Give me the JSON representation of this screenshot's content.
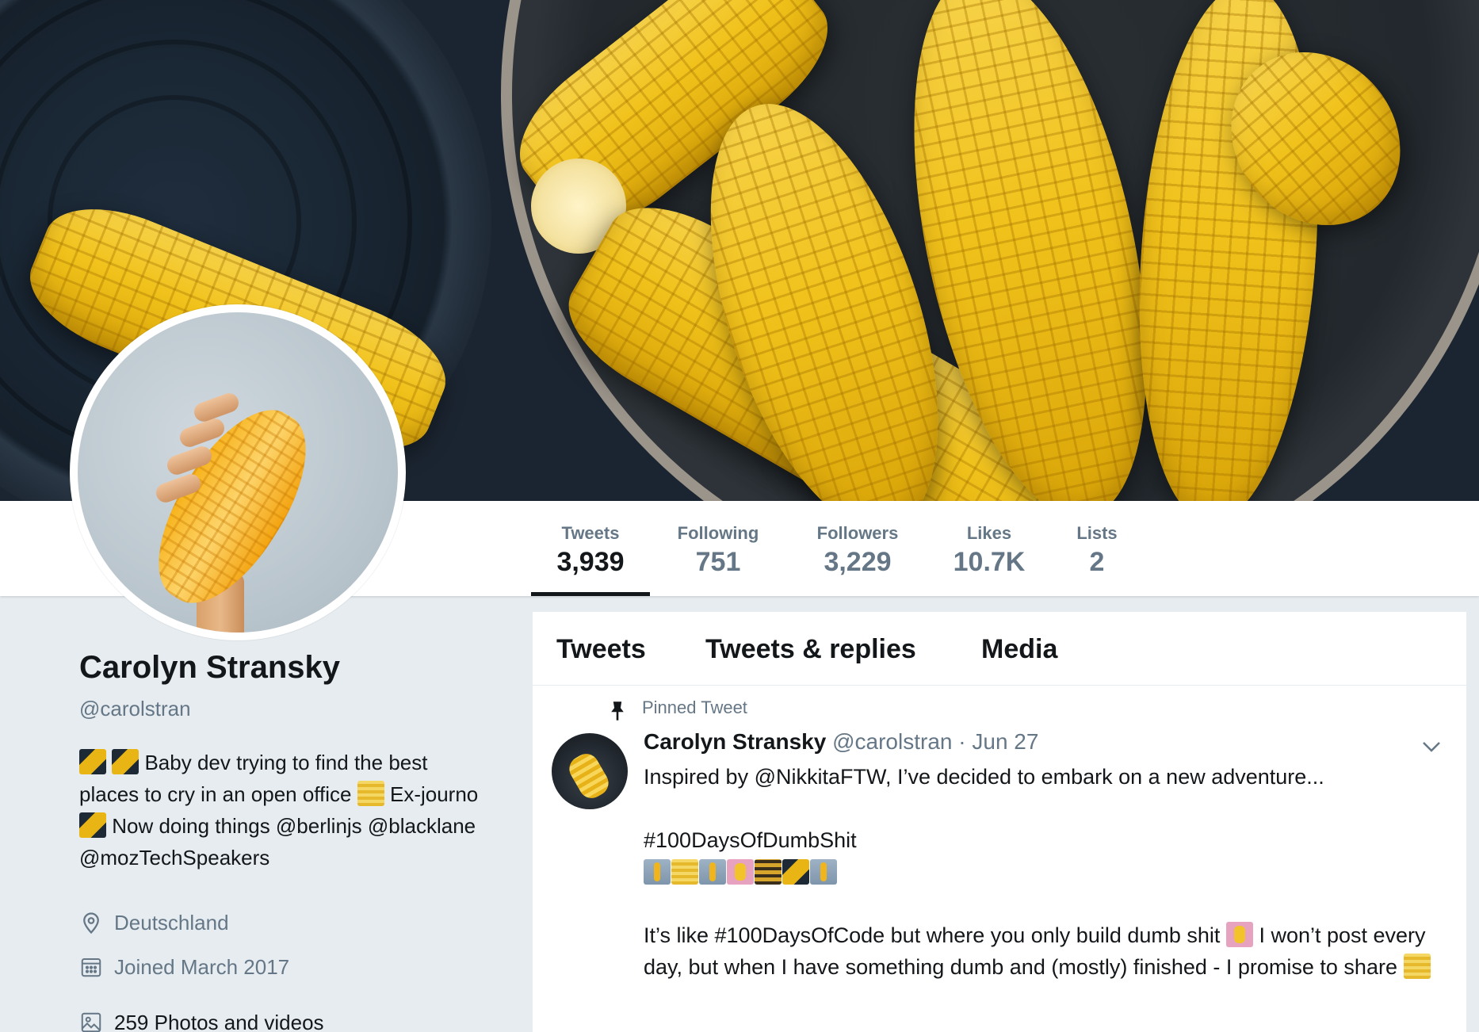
{
  "profile": {
    "name": "Carolyn Stransky",
    "handle": "@carolstran",
    "bio_part1": "Baby dev trying to find the best places to cry in an open office",
    "bio_part2": "Ex-journo",
    "bio_part3": "Now doing things @berlinjs @blacklane @mozTechSpeakers",
    "location": "Deutschland",
    "joined": "Joined March 2017",
    "photos": "259 Photos and videos"
  },
  "stats": [
    {
      "label": "Tweets",
      "value": "3,939"
    },
    {
      "label": "Following",
      "value": "751"
    },
    {
      "label": "Followers",
      "value": "3,229"
    },
    {
      "label": "Likes",
      "value": "10.7K"
    },
    {
      "label": "Lists",
      "value": "2"
    }
  ],
  "timeline": {
    "tabs": [
      "Tweets",
      "Tweets & replies",
      "Media"
    ],
    "pinned_label": "Pinned Tweet",
    "tweet": {
      "author": "Carolyn Stransky",
      "handle": "@carolstran",
      "date": "· Jun 27",
      "line1": "Inspired by @NikkitaFTW, I’ve decided to embark on a new adventure...",
      "hashtag": "#100DaysOfDumbShit",
      "line3": "It’s like #100DaysOfCode but where you only build dumb shit",
      "line4": "I won’t post every day, but when I have something dumb and (mostly) finished - I promise to share"
    }
  },
  "icons": [
    "location-icon",
    "calendar-icon",
    "photo-icon",
    "pin-icon",
    "chevron-down-icon"
  ],
  "colors": {
    "text": "#14171a",
    "secondary": "#657786",
    "background": "#e6ecf0",
    "corn": "#f1c21b"
  }
}
